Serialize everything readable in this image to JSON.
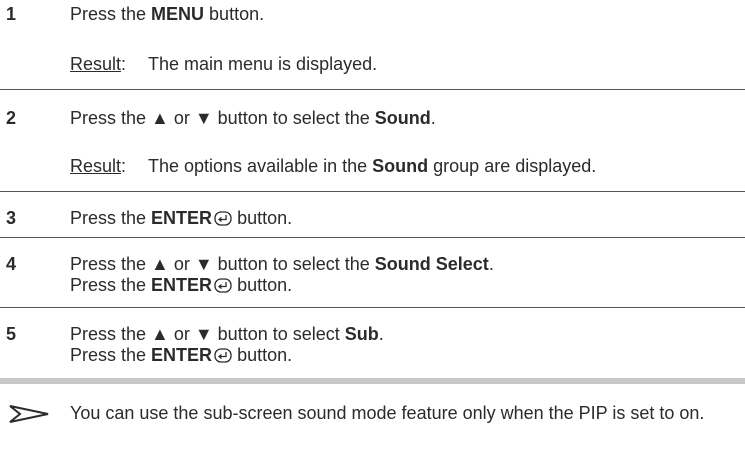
{
  "steps": [
    {
      "number": "1",
      "line1_pre": "Press the ",
      "line1_bold": "MENU",
      "line1_post": " button.",
      "result_label": "Result",
      "result_colon": ":",
      "result_text": "The main menu is displayed."
    },
    {
      "number": "2",
      "line1_pre": "Press the ▲ or ▼ button to select the ",
      "line1_bold": "Sound",
      "line1_post": ".",
      "result_label": "Result",
      "result_colon": ":",
      "result_pre": "The options available in the ",
      "result_bold": "Sound",
      "result_post": " group are displayed."
    },
    {
      "number": "3",
      "line1_pre": "Press the ",
      "line1_bold": "ENTER",
      "line1_post": " button."
    },
    {
      "number": "4",
      "line1_pre": "Press the ▲ or ▼ button to select the ",
      "line1_bold": "Sound Select",
      "line1_post": ".",
      "line2_pre": "Press the ",
      "line2_bold": "ENTER",
      "line2_post": " button."
    },
    {
      "number": "5",
      "line1_pre": "Press the ▲ or ▼ button to select ",
      "line1_bold": "Sub",
      "line1_post": ".",
      "line2_pre": "Press the ",
      "line2_bold": "ENTER",
      "line2_post": " button."
    }
  ],
  "note": {
    "icon": "arrow-note-icon",
    "text": "You can use the sub-screen sound mode feature only when the PIP is set to on."
  },
  "icons": {
    "enter": "enter-icon"
  }
}
